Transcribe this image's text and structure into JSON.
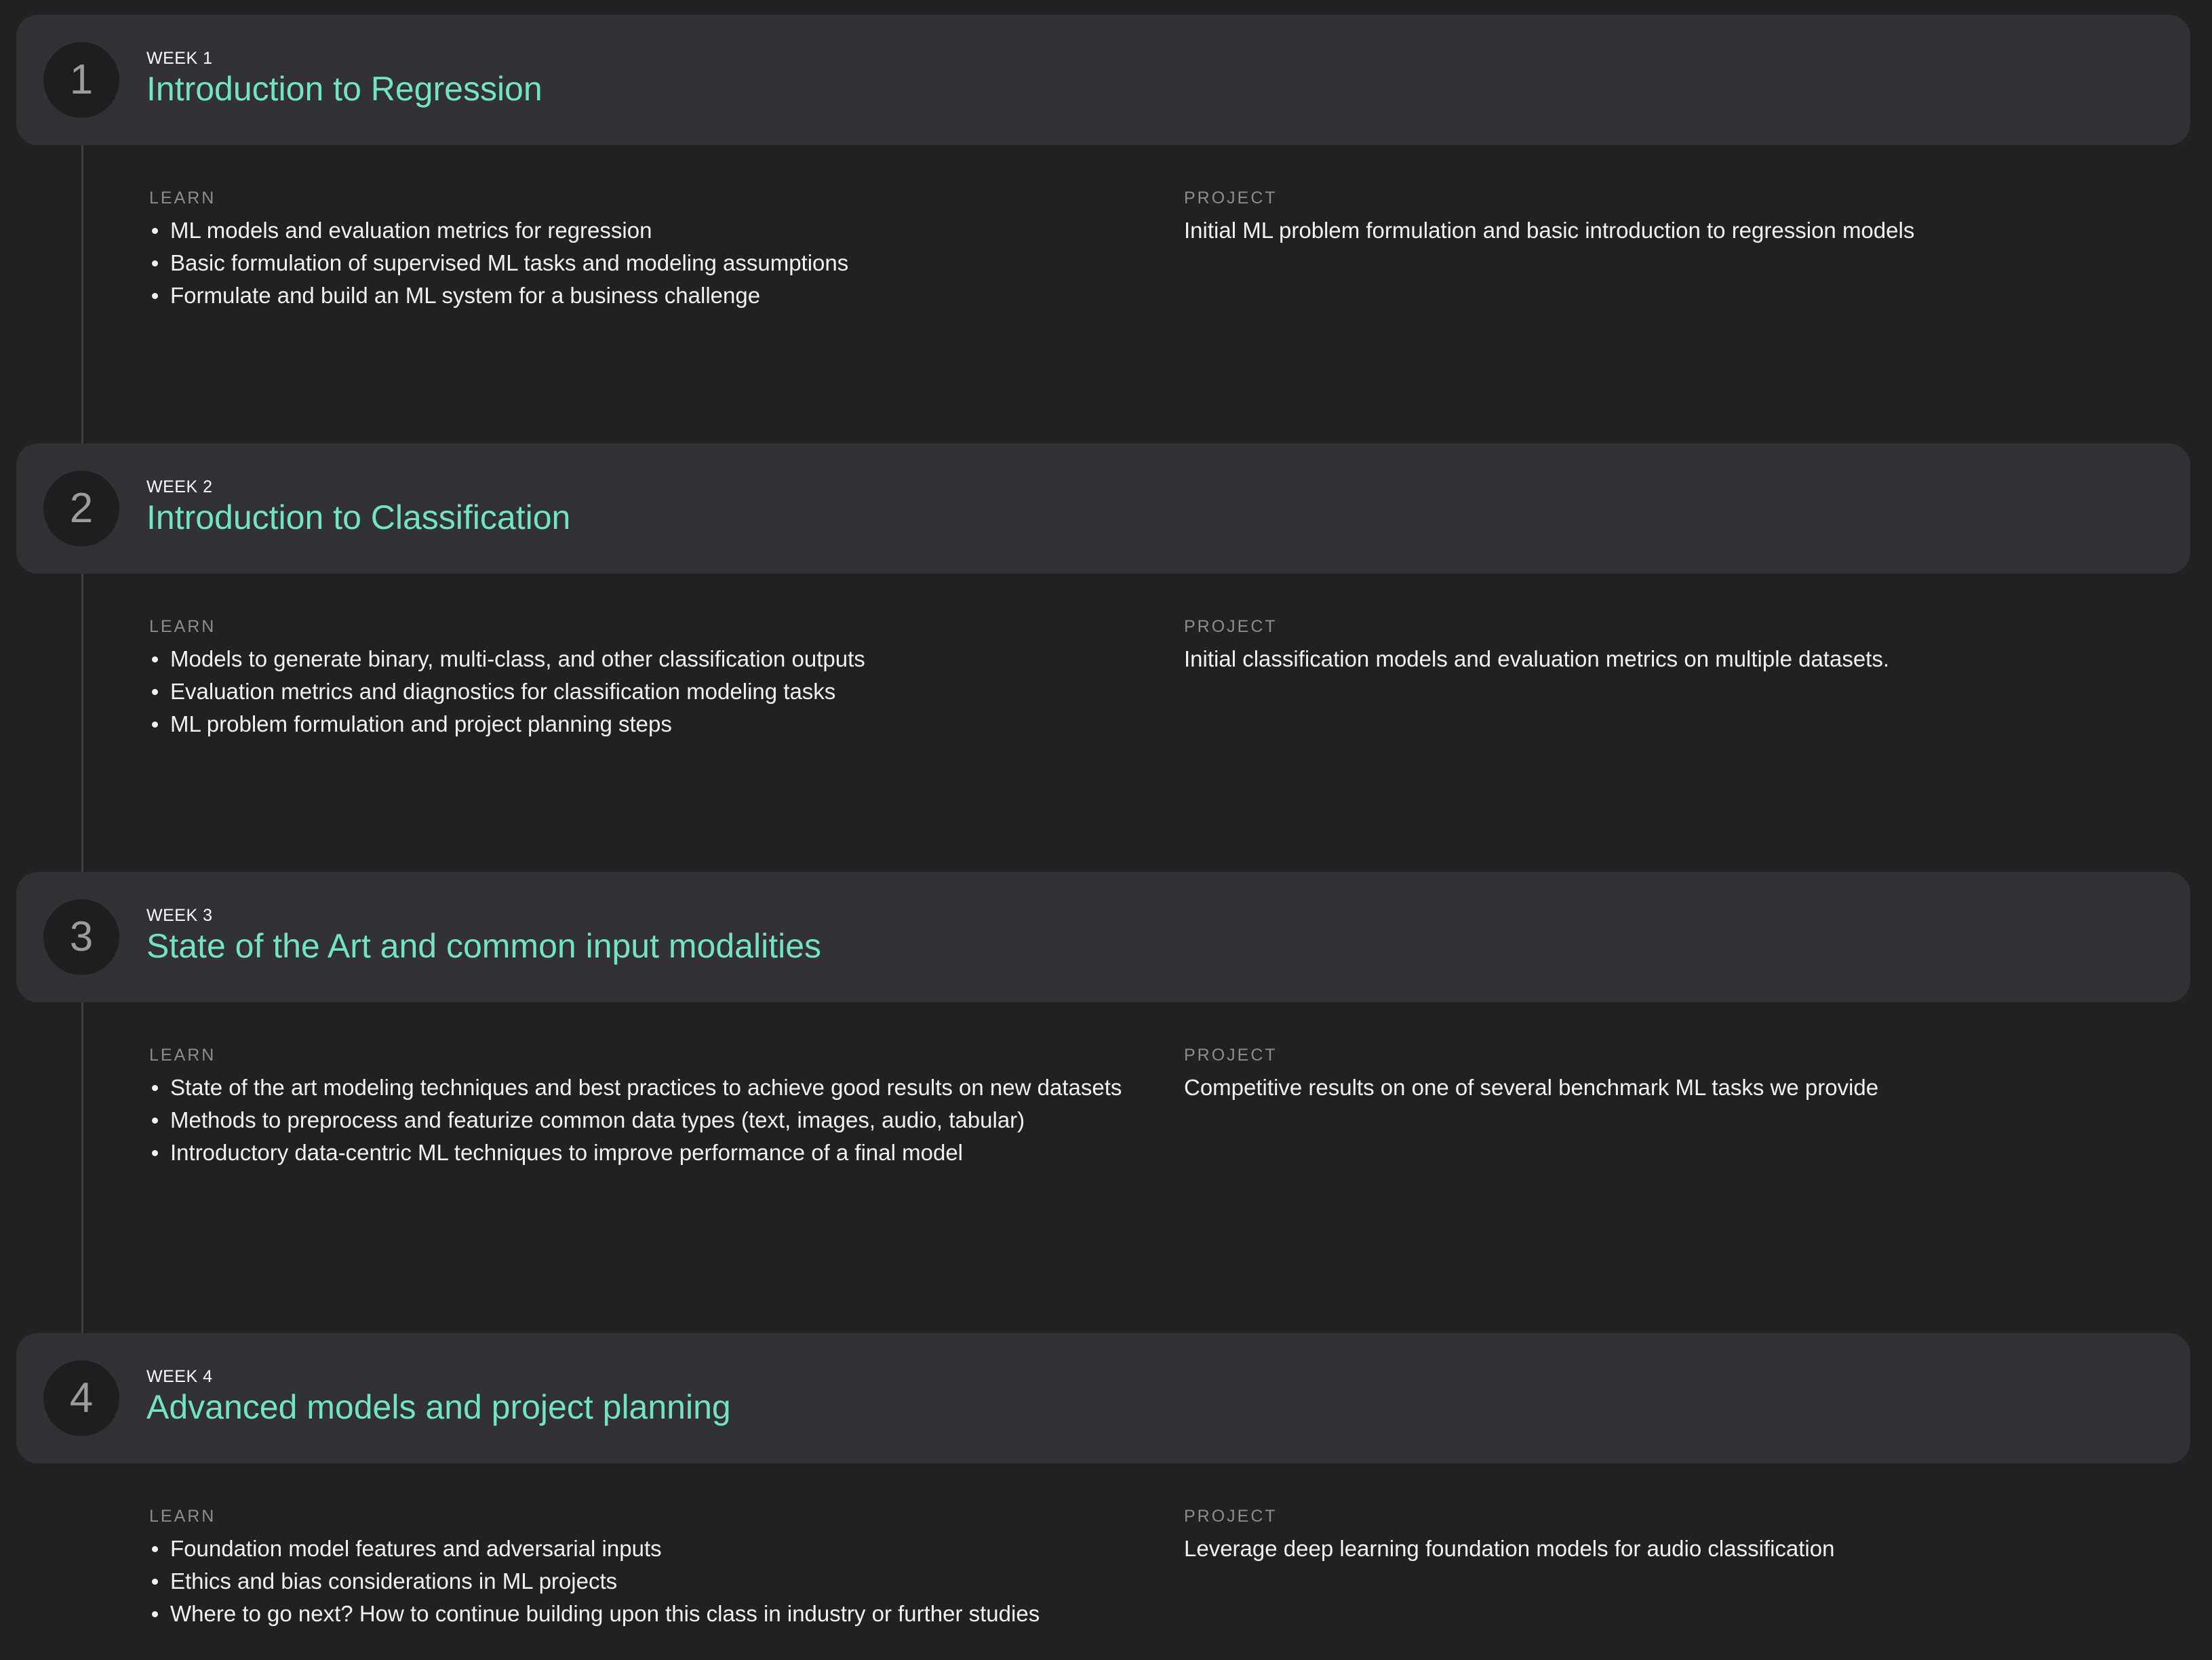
{
  "weeks": [
    {
      "number": "1",
      "label": "WEEK 1",
      "title": "Introduction to Regression",
      "learn_heading": "LEARN",
      "learn_items": [
        "ML models and evaluation metrics for regression",
        "Basic formulation of supervised ML tasks and modeling assumptions",
        "Formulate and build an ML system for a business challenge"
      ],
      "project_heading": "PROJECT",
      "project_text": "Initial ML problem formulation and basic introduction to regression models"
    },
    {
      "number": "2",
      "label": "WEEK 2",
      "title": "Introduction to Classification",
      "learn_heading": "LEARN",
      "learn_items": [
        "Models to generate binary, multi-class, and other classification outputs",
        "Evaluation metrics and diagnostics for classification modeling tasks",
        "ML problem formulation and project planning steps"
      ],
      "project_heading": "PROJECT",
      "project_text": "Initial classification models and evaluation metrics on multiple datasets."
    },
    {
      "number": "3",
      "label": "WEEK 3",
      "title": "State of the Art and common input modalities",
      "learn_heading": "LEARN",
      "learn_items": [
        "State of the art modeling techniques and best practices to achieve good results on new datasets",
        "Methods to preprocess and featurize common data types (text, images, audio, tabular)",
        "Introductory data-centric ML techniques to improve performance of a final model"
      ],
      "project_heading": "PROJECT",
      "project_text": "Competitive results on one of several benchmark ML tasks we provide"
    },
    {
      "number": "4",
      "label": "WEEK 4",
      "title": "Advanced models and project planning",
      "learn_heading": "LEARN",
      "learn_items": [
        "Foundation model features and adversarial inputs",
        "Ethics and bias considerations in ML projects",
        "Where to go next? How to continue building upon this class in industry or further studies"
      ],
      "project_heading": "PROJECT",
      "project_text": "Leverage deep learning foundation models for audio classification"
    }
  ]
}
